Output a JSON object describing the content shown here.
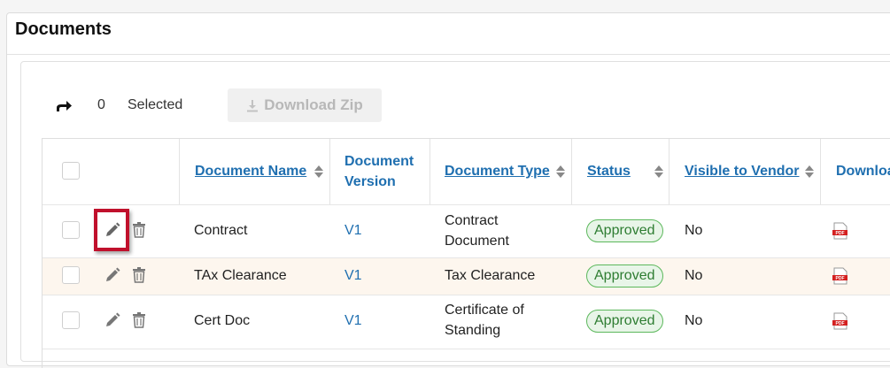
{
  "panel": {
    "title": "Documents"
  },
  "toolbar": {
    "selected_count": "0",
    "selected_label": "Selected",
    "download_zip_label": "Download Zip"
  },
  "table": {
    "columns": {
      "document_name": "Document Name",
      "document_version_line1": "Document",
      "document_version_line2": "Version",
      "document_type": "Document Type",
      "status": "Status",
      "visible_to_vendor": "Visible to Vendor",
      "download": "Downloa"
    },
    "rows": [
      {
        "name": "Contract",
        "version": "V1",
        "type_line1": "Contract",
        "type_line2": "Document",
        "status": "Approved",
        "visible": "No"
      },
      {
        "name": "TAx Clearance",
        "version": "V1",
        "type_line1": "Tax Clearance",
        "type_line2": "",
        "status": "Approved",
        "visible": "No"
      },
      {
        "name": "Cert Doc",
        "version": "V1",
        "type_line1": "Certificate of",
        "type_line2": "Standing",
        "status": "Approved",
        "visible": "No"
      }
    ]
  },
  "icons": {
    "share": "share-arrow-icon",
    "download": "download-icon",
    "edit": "pencil-icon",
    "delete": "trash-icon",
    "pdf": "pdf-file-icon",
    "sort": "sort-icon"
  },
  "colors": {
    "link": "#1f6fb0",
    "status_bg": "#e8f5e8",
    "status_border": "#5cb85c",
    "highlight": "#c0102c",
    "row_hover": "#fdf6ee"
  }
}
